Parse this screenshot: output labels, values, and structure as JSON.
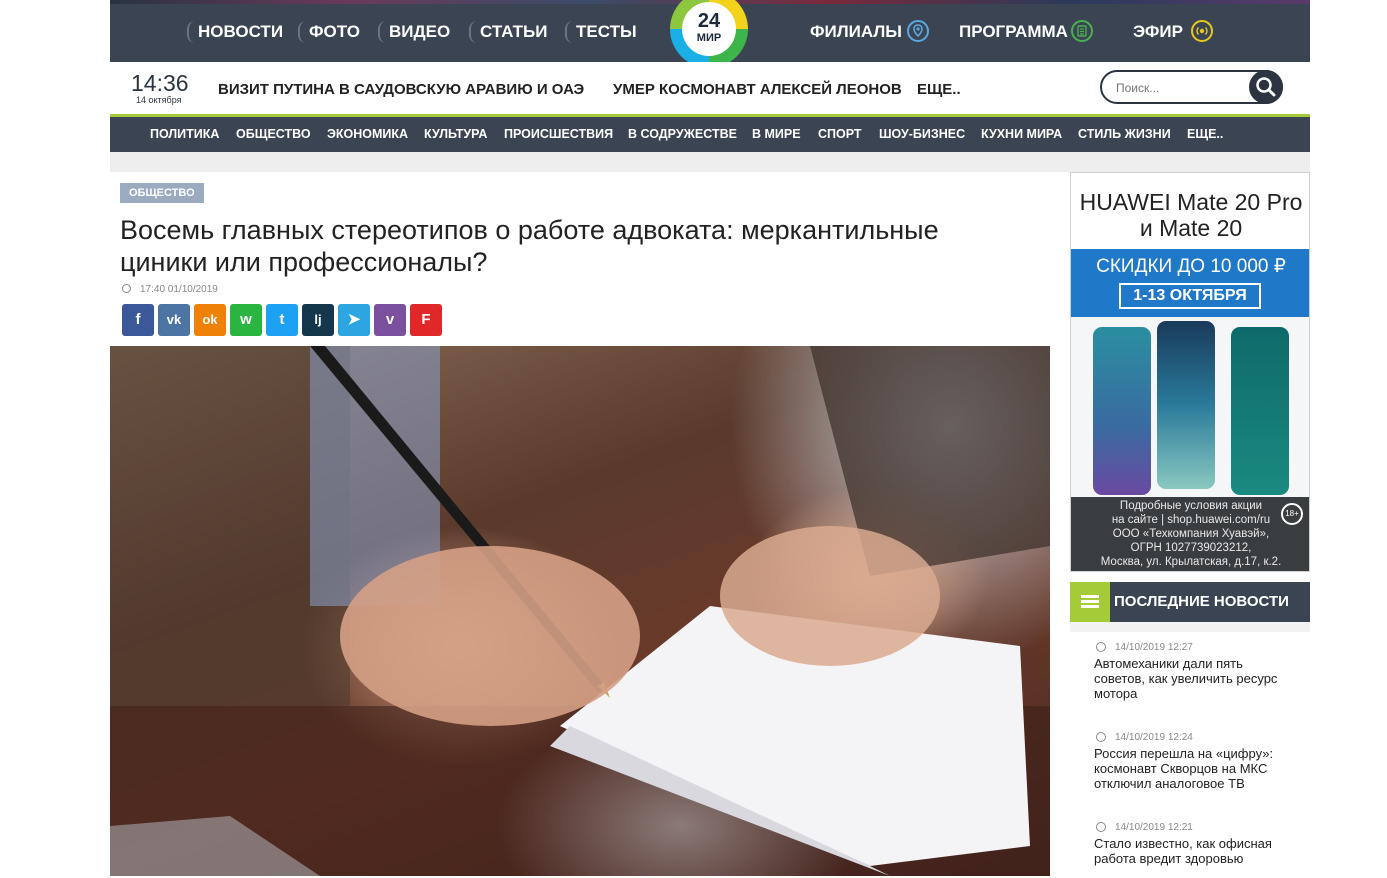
{
  "nav": {
    "left": [
      "НОВОСТИ",
      "ФОТО",
      "ВИДЕО",
      "СТАТЬИ",
      "ТЕСТЫ"
    ],
    "right": [
      {
        "label": "ФИЛИАЛЫ",
        "icon": "map-pin-icon"
      },
      {
        "label": "ПРОГРАММА",
        "icon": "list-icon"
      },
      {
        "label": "ЭФИР",
        "icon": "broadcast-icon"
      }
    ],
    "logo_number": "24",
    "logo_text": "МИР"
  },
  "ticker": {
    "time": "14:36",
    "date": "14 октября",
    "items": [
      "ВИЗИТ ПУТИНА В САУДОВСКУЮ АРАВИЮ И ОАЭ",
      "УМЕР КОСМОНАВТ АЛЕКСЕЙ ЛЕОНОВ",
      "ЕЩЕ.."
    ],
    "search_placeholder": "Поиск..."
  },
  "categories": [
    "ПОЛИТИКА",
    "ОБЩЕСТВО",
    "ЭКОНОМИКА",
    "КУЛЬТУРА",
    "ПРОИСШЕСТВИЯ",
    "В СОДРУЖЕСТВЕ",
    "В МИРЕ",
    "СПОРТ",
    "ШОУ-БИЗНЕС",
    "КУХНИ МИРА",
    "СТИЛЬ ЖИЗНИ",
    "ЕЩЕ.."
  ],
  "article": {
    "rubric": "ОБЩЕСТВО",
    "title_line1": "Восемь главных стереотипов о работе адвоката: меркантильные",
    "title_line2": "циники или профессионалы?",
    "published": "17:40 01/10/2019",
    "share": [
      {
        "name": "facebook",
        "glyph": "f",
        "color": "#3b5998"
      },
      {
        "name": "vk",
        "glyph": "vk",
        "color": "#4c75a3"
      },
      {
        "name": "odnoklassniki",
        "glyph": "ok",
        "color": "#ee8208"
      },
      {
        "name": "whatsapp",
        "glyph": "w",
        "color": "#2ab540"
      },
      {
        "name": "twitter",
        "glyph": "t",
        "color": "#1da1f2"
      },
      {
        "name": "livejournal",
        "glyph": "lj",
        "color": "#15374c"
      },
      {
        "name": "telegram",
        "glyph": "➤",
        "color": "#2ca5e0"
      },
      {
        "name": "viber",
        "glyph": "v",
        "color": "#7b519d"
      },
      {
        "name": "flipboard",
        "glyph": "F",
        "color": "#e12828"
      }
    ]
  },
  "ad": {
    "line1": "HUAWEI Mate 20 Pro",
    "line2": "и Mate 20",
    "sale": "СКИДКИ ДО 10 000 ₽",
    "dates": "1-13 ОКТЯБРЯ",
    "fine_lines": [
      "Подробные условия акции",
      "на сайте | shop.huawei.com/ru",
      "ООО «Техкомпания Хуавэй»,",
      "ОГРН 1027739023212,",
      "Москва, ул. Крылатская, д.17, к.2."
    ],
    "age": "18+"
  },
  "latest": {
    "title": "ПОСЛЕДНИЕ НОВОСТИ",
    "items": [
      {
        "time": "14/10/2019 12:27",
        "title": "Автомеханики дали пять советов, как увеличить ресурс мотора"
      },
      {
        "time": "14/10/2019 12:24",
        "title": "Россия перешла на «цифру»: космонавт Скворцов на МКС отключил аналоговое ТВ"
      },
      {
        "time": "14/10/2019 12:21",
        "title": "Стало известно, как офисная работа вредит здоровью"
      }
    ]
  },
  "colors": {
    "nav_bg": "#3a4452",
    "accent_green": "#a4cc39",
    "rubric_badge": "#9aaabf",
    "ad_blue": "#1f78c8"
  }
}
